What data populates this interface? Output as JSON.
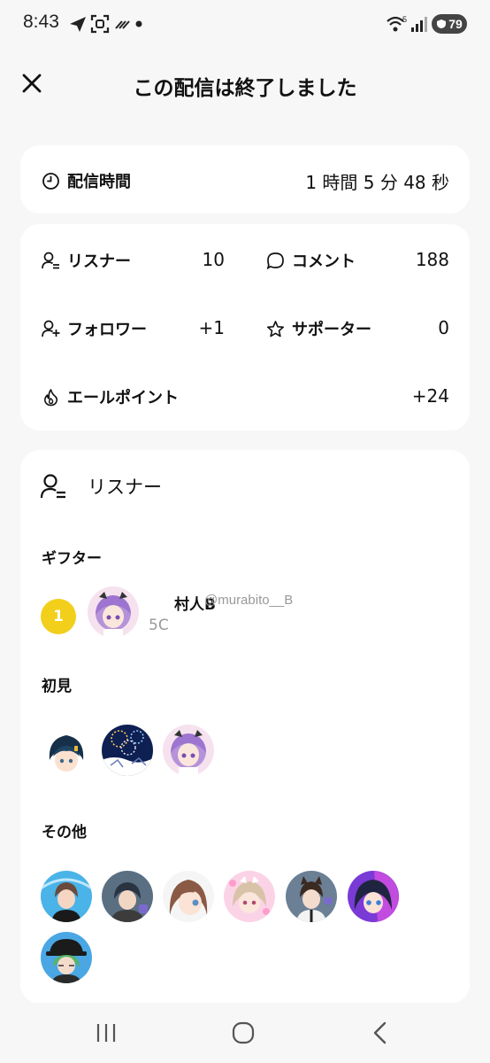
{
  "status_bar": {
    "time": "8:43",
    "battery": "79"
  },
  "header": {
    "title": "この配信は終了しました"
  },
  "duration": {
    "label": "配信時間",
    "value": "1 時間 5 分 48 秒"
  },
  "stats": {
    "listeners": {
      "label": "リスナー",
      "value": "10"
    },
    "comments": {
      "label": "コメント",
      "value": "188"
    },
    "followers": {
      "label": "フォロワー",
      "value": "+1"
    },
    "supporters": {
      "label": "サポーター",
      "value": "0"
    },
    "yell_points": {
      "label": "エールポイント",
      "value": "+24"
    }
  },
  "listeners_section": {
    "title": "リスナー",
    "gifters_label": "ギフター",
    "gifter": {
      "rank": "1",
      "name": "村人B",
      "handle": "@murabito__B",
      "coins": "5C"
    },
    "first_time_label": "初見",
    "others_label": "その他"
  }
}
